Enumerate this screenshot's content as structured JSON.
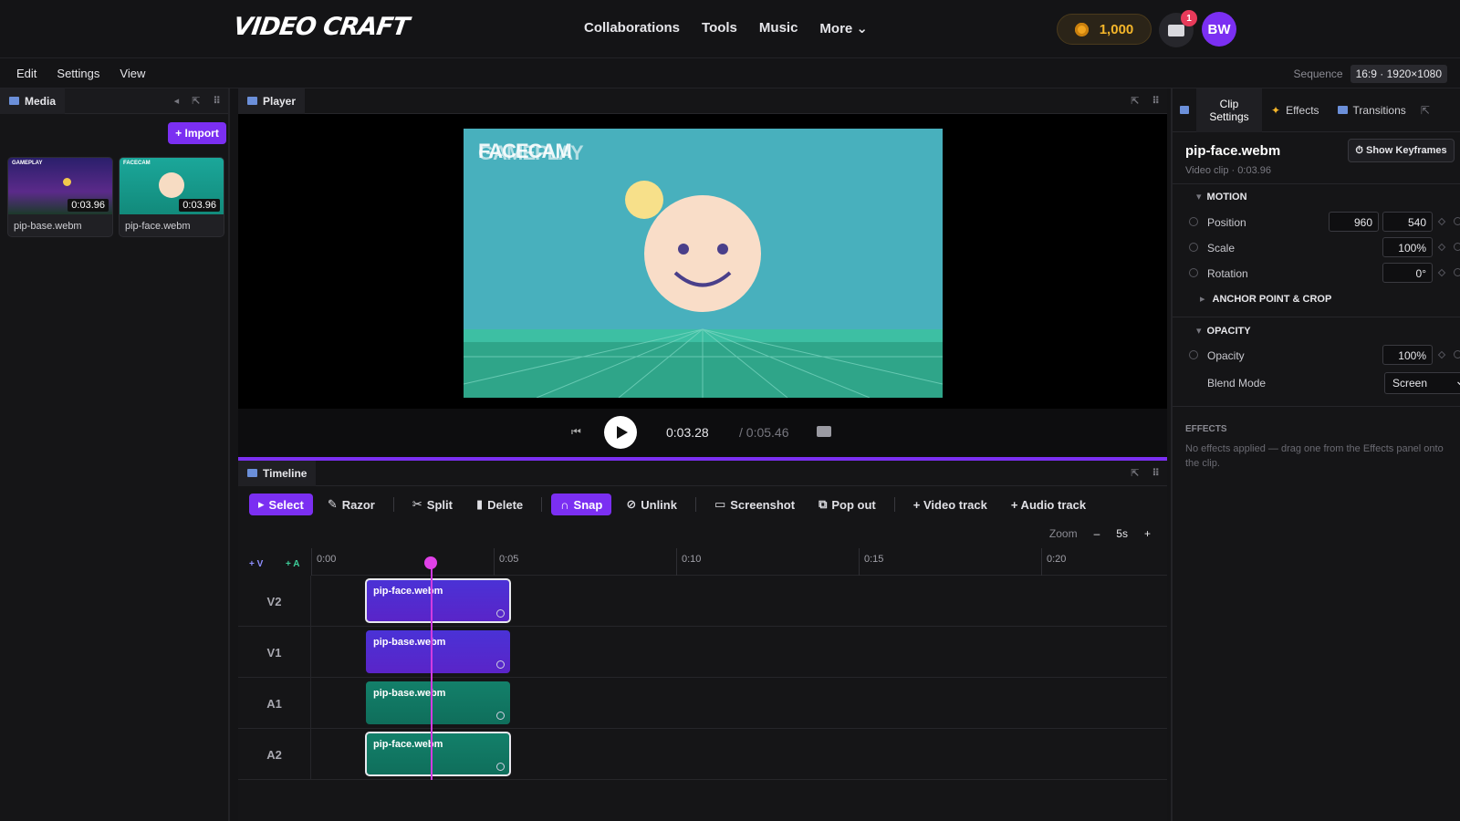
{
  "app": {
    "logo": "VIDEO CRAFT"
  },
  "nav": {
    "items": [
      "Collaborations",
      "Tools",
      "Music",
      "More ⌄"
    ]
  },
  "user": {
    "coins": "1,000",
    "notifications": "1",
    "initials": "BW"
  },
  "menu": {
    "items": [
      "Edit",
      "Settings",
      "View"
    ]
  },
  "sequence": {
    "label": "Sequence",
    "value": "16:9 · 1920×1080"
  },
  "media": {
    "title": "Media",
    "import_label": "+ Import",
    "items": [
      {
        "name": "pip-base.webm",
        "duration": "0:03.96",
        "tag": "GAMEPLAY"
      },
      {
        "name": "pip-face.webm",
        "duration": "0:03.96",
        "tag": "FACECAM"
      }
    ]
  },
  "player": {
    "title": "Player",
    "overlay_text_1": "FACECAM",
    "overlay_text_2": "GAMEPLAY",
    "current_time": "0:03.28",
    "total_time": "/ 0:05.46"
  },
  "timeline": {
    "title": "Timeline",
    "tools": {
      "select": "Select",
      "razor": "Razor",
      "split": "Split",
      "delete": "Delete",
      "snap": "Snap",
      "unlink": "Unlink",
      "screenshot": "Screenshot",
      "popout": "Pop out",
      "add_video": "+ Video track",
      "add_audio": "+ Audio track"
    },
    "zoom": {
      "label": "Zoom",
      "minus": "–",
      "value": "5s",
      "plus": "+"
    },
    "add_v": "+ V",
    "add_a": "+ A",
    "ruler": [
      "0:00",
      "0:05",
      "0:10",
      "0:15",
      "0:20"
    ],
    "tracks": [
      {
        "label": "V2",
        "clip": "pip-face.webm"
      },
      {
        "label": "V1",
        "clip": "pip-base.webm"
      },
      {
        "label": "A1",
        "clip": "pip-base.webm"
      },
      {
        "label": "A2",
        "clip": "pip-face.webm"
      }
    ]
  },
  "inspector": {
    "tabs": {
      "clip": "Clip Settings",
      "effects": "Effects",
      "transitions": "Transitions"
    },
    "clip_name": "pip-face.webm",
    "clip_sub": "Video clip · 0:03.96",
    "keyframes": "⏱ Show Keyframes",
    "motion": {
      "title": "MOTION",
      "position_label": "Position",
      "pos_x": "960",
      "pos_y": "540",
      "scale_label": "Scale",
      "scale": "100%",
      "rotation_label": "Rotation",
      "rotation": "0°",
      "anchor": "ANCHOR POINT & CROP"
    },
    "opacity": {
      "title": "OPACITY",
      "opacity_label": "Opacity",
      "opacity": "100%",
      "blend_label": "Blend Mode",
      "blend": "Screen"
    },
    "effects": {
      "title": "EFFECTS",
      "empty": "No effects applied — drag one from the Effects panel onto the clip."
    }
  },
  "colors": {
    "accent": "#7b2ff2",
    "playhead": "#e041e8",
    "video_clip": "#4a32d6",
    "audio_clip": "#13806a"
  }
}
